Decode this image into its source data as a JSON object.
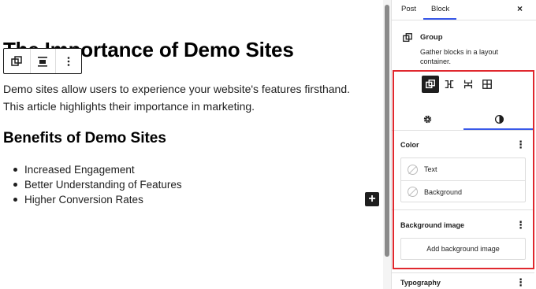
{
  "editor": {
    "title": "The Importance of Demo Sites",
    "paragraph": "Demo sites allow users to experience your website's features firsthand. This article highlights their importance in marketing.",
    "heading": "Benefits of Demo Sites",
    "list_items": [
      "Increased Engagement",
      "Better Understanding of Features",
      "Higher Conversion Rates"
    ],
    "toolbar": {
      "buttons": [
        "group-icon",
        "align-icon",
        "more-options-icon"
      ]
    },
    "add_block_label": "+"
  },
  "sidebar": {
    "tabs": [
      "Post",
      "Block"
    ],
    "active_tab": "Block",
    "close_label": "×",
    "block_card": {
      "title": "Group",
      "description": "Gather blocks in a layout container."
    },
    "variations": [
      "group-icon",
      "row-icon",
      "stack-icon",
      "grid-icon"
    ],
    "inspector_tabs": [
      "settings-icon",
      "styles-icon"
    ],
    "color": {
      "title": "Color",
      "items": [
        "Text",
        "Background"
      ]
    },
    "background_image": {
      "title": "Background image",
      "button_label": "Add background image"
    },
    "typography": {
      "title": "Typography"
    },
    "kebab_label": "⋮"
  },
  "colors": {
    "accent": "#3858e9",
    "highlight": "#e0282e",
    "dark": "#1e1e1e"
  }
}
